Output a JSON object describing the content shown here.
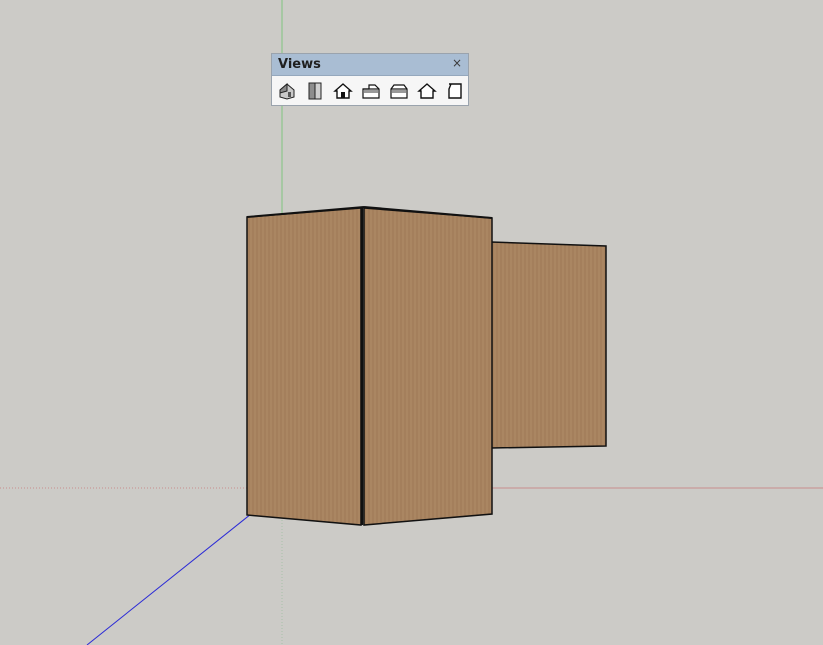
{
  "views_toolbar": {
    "title": "Views",
    "close_label": "×",
    "buttons": [
      {
        "name": "iso-view",
        "icon": "iso-house-icon"
      },
      {
        "name": "top-view",
        "icon": "top-view-icon"
      },
      {
        "name": "front-view",
        "icon": "front-house-icon"
      },
      {
        "name": "right-view",
        "icon": "right-house-icon"
      },
      {
        "name": "back-view",
        "icon": "back-house-icon"
      },
      {
        "name": "left-view",
        "icon": "left-house-icon"
      },
      {
        "name": "bottom-view",
        "icon": "bottom-view-icon"
      }
    ]
  },
  "scene": {
    "background_color": "#cccbc7",
    "wood_color": "#a8835f",
    "axis_colors": {
      "green": "#7fc47f",
      "red": "#c98d8d",
      "blue": "#2b2bd6"
    }
  }
}
